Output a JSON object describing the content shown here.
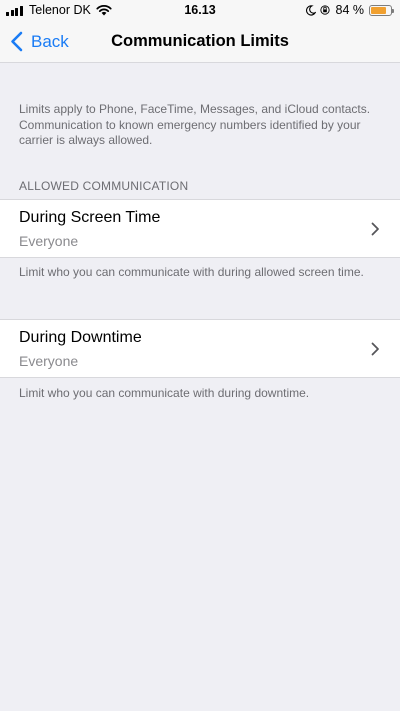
{
  "status_bar": {
    "carrier": "Telenor DK",
    "time": "16.13",
    "battery_percent": "84 %",
    "battery_level": 0.84,
    "icons": [
      "signal-icon",
      "wifi-icon",
      "moon-icon",
      "orientation-lock-icon",
      "battery-icon"
    ]
  },
  "nav": {
    "back_label": "Back",
    "title": "Communication Limits"
  },
  "intro_text": "Limits apply to Phone, FaceTime, Messages, and iCloud contacts. Communication to known emergency numbers identified by your carrier is always allowed.",
  "section": {
    "header": "ALLOWED COMMUNICATION",
    "rows": [
      {
        "title": "During Screen Time",
        "value": "Everyone",
        "footer": "Limit who you can communicate with during allowed screen time."
      },
      {
        "title": "During Downtime",
        "value": "Everyone",
        "footer": "Limit who you can communicate with during downtime."
      }
    ]
  },
  "colors": {
    "accent": "#1a7cf5",
    "background": "#efeff4",
    "secondary_text": "#6d6d72",
    "battery": "#f0a030"
  }
}
